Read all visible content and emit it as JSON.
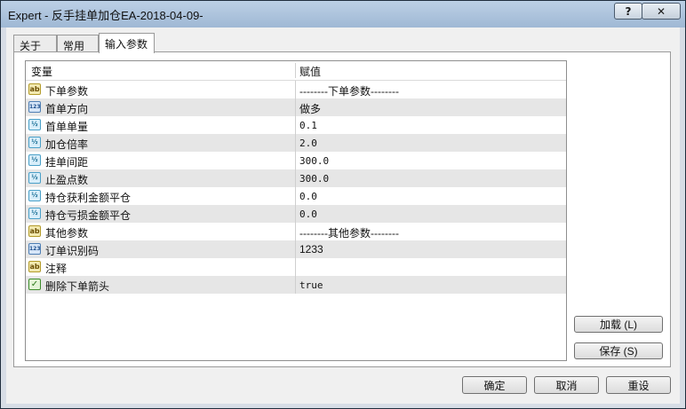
{
  "window": {
    "title": "Expert - 反手挂单加仓EA-2018-04-09-",
    "help_label": "?",
    "close_label": "✕"
  },
  "tabs": [
    {
      "label": "关于"
    },
    {
      "label": "常用"
    },
    {
      "label": "输入参数"
    }
  ],
  "grid": {
    "headers": {
      "variable": "变量",
      "value": "赋值"
    },
    "rows": [
      {
        "icon": "ab",
        "name": "下单参数",
        "value": "--------下单参数--------"
      },
      {
        "icon": "123",
        "name": "首单方向",
        "value": "做多"
      },
      {
        "icon": "½",
        "name": "首单单量",
        "value": "0.1"
      },
      {
        "icon": "½",
        "name": "加仓倍率",
        "value": "2.0"
      },
      {
        "icon": "½",
        "name": "挂单间距",
        "value": "300.0"
      },
      {
        "icon": "½",
        "name": "止盈点数",
        "value": "300.0"
      },
      {
        "icon": "½",
        "name": "持仓获利金额平仓",
        "value": "0.0"
      },
      {
        "icon": "½",
        "name": "持仓亏损金额平仓",
        "value": "0.0"
      },
      {
        "icon": "ab",
        "name": "其他参数",
        "value": "--------其他参数--------"
      },
      {
        "icon": "123",
        "name": "订单识别码",
        "value": "1233"
      },
      {
        "icon": "ab",
        "name": "注释",
        "value": ""
      },
      {
        "icon": "✓",
        "name": "删除下单箭头",
        "value": "true"
      }
    ]
  },
  "buttons": {
    "load": "加载 (L)",
    "save": "保存 (S)",
    "ok": "确定",
    "cancel": "取消",
    "reset": "重设"
  }
}
